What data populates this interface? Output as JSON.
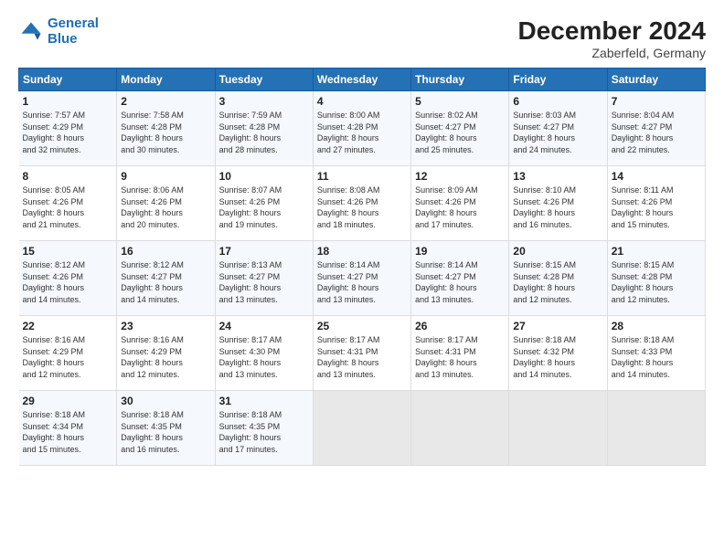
{
  "header": {
    "logo_line1": "General",
    "logo_line2": "Blue",
    "month_year": "December 2024",
    "location": "Zaberfeld, Germany"
  },
  "weekdays": [
    "Sunday",
    "Monday",
    "Tuesday",
    "Wednesday",
    "Thursday",
    "Friday",
    "Saturday"
  ],
  "weeks": [
    [
      {
        "day": "1",
        "text": "Sunrise: 7:57 AM\nSunset: 4:29 PM\nDaylight: 8 hours\nand 32 minutes."
      },
      {
        "day": "2",
        "text": "Sunrise: 7:58 AM\nSunset: 4:28 PM\nDaylight: 8 hours\nand 30 minutes."
      },
      {
        "day": "3",
        "text": "Sunrise: 7:59 AM\nSunset: 4:28 PM\nDaylight: 8 hours\nand 28 minutes."
      },
      {
        "day": "4",
        "text": "Sunrise: 8:00 AM\nSunset: 4:28 PM\nDaylight: 8 hours\nand 27 minutes."
      },
      {
        "day": "5",
        "text": "Sunrise: 8:02 AM\nSunset: 4:27 PM\nDaylight: 8 hours\nand 25 minutes."
      },
      {
        "day": "6",
        "text": "Sunrise: 8:03 AM\nSunset: 4:27 PM\nDaylight: 8 hours\nand 24 minutes."
      },
      {
        "day": "7",
        "text": "Sunrise: 8:04 AM\nSunset: 4:27 PM\nDaylight: 8 hours\nand 22 minutes."
      }
    ],
    [
      {
        "day": "8",
        "text": "Sunrise: 8:05 AM\nSunset: 4:26 PM\nDaylight: 8 hours\nand 21 minutes."
      },
      {
        "day": "9",
        "text": "Sunrise: 8:06 AM\nSunset: 4:26 PM\nDaylight: 8 hours\nand 20 minutes."
      },
      {
        "day": "10",
        "text": "Sunrise: 8:07 AM\nSunset: 4:26 PM\nDaylight: 8 hours\nand 19 minutes."
      },
      {
        "day": "11",
        "text": "Sunrise: 8:08 AM\nSunset: 4:26 PM\nDaylight: 8 hours\nand 18 minutes."
      },
      {
        "day": "12",
        "text": "Sunrise: 8:09 AM\nSunset: 4:26 PM\nDaylight: 8 hours\nand 17 minutes."
      },
      {
        "day": "13",
        "text": "Sunrise: 8:10 AM\nSunset: 4:26 PM\nDaylight: 8 hours\nand 16 minutes."
      },
      {
        "day": "14",
        "text": "Sunrise: 8:11 AM\nSunset: 4:26 PM\nDaylight: 8 hours\nand 15 minutes."
      }
    ],
    [
      {
        "day": "15",
        "text": "Sunrise: 8:12 AM\nSunset: 4:26 PM\nDaylight: 8 hours\nand 14 minutes."
      },
      {
        "day": "16",
        "text": "Sunrise: 8:12 AM\nSunset: 4:27 PM\nDaylight: 8 hours\nand 14 minutes."
      },
      {
        "day": "17",
        "text": "Sunrise: 8:13 AM\nSunset: 4:27 PM\nDaylight: 8 hours\nand 13 minutes."
      },
      {
        "day": "18",
        "text": "Sunrise: 8:14 AM\nSunset: 4:27 PM\nDaylight: 8 hours\nand 13 minutes."
      },
      {
        "day": "19",
        "text": "Sunrise: 8:14 AM\nSunset: 4:27 PM\nDaylight: 8 hours\nand 13 minutes."
      },
      {
        "day": "20",
        "text": "Sunrise: 8:15 AM\nSunset: 4:28 PM\nDaylight: 8 hours\nand 12 minutes."
      },
      {
        "day": "21",
        "text": "Sunrise: 8:15 AM\nSunset: 4:28 PM\nDaylight: 8 hours\nand 12 minutes."
      }
    ],
    [
      {
        "day": "22",
        "text": "Sunrise: 8:16 AM\nSunset: 4:29 PM\nDaylight: 8 hours\nand 12 minutes."
      },
      {
        "day": "23",
        "text": "Sunrise: 8:16 AM\nSunset: 4:29 PM\nDaylight: 8 hours\nand 12 minutes."
      },
      {
        "day": "24",
        "text": "Sunrise: 8:17 AM\nSunset: 4:30 PM\nDaylight: 8 hours\nand 13 minutes."
      },
      {
        "day": "25",
        "text": "Sunrise: 8:17 AM\nSunset: 4:31 PM\nDaylight: 8 hours\nand 13 minutes."
      },
      {
        "day": "26",
        "text": "Sunrise: 8:17 AM\nSunset: 4:31 PM\nDaylight: 8 hours\nand 13 minutes."
      },
      {
        "day": "27",
        "text": "Sunrise: 8:18 AM\nSunset: 4:32 PM\nDaylight: 8 hours\nand 14 minutes."
      },
      {
        "day": "28",
        "text": "Sunrise: 8:18 AM\nSunset: 4:33 PM\nDaylight: 8 hours\nand 14 minutes."
      }
    ],
    [
      {
        "day": "29",
        "text": "Sunrise: 8:18 AM\nSunset: 4:34 PM\nDaylight: 8 hours\nand 15 minutes."
      },
      {
        "day": "30",
        "text": "Sunrise: 8:18 AM\nSunset: 4:35 PM\nDaylight: 8 hours\nand 16 minutes."
      },
      {
        "day": "31",
        "text": "Sunrise: 8:18 AM\nSunset: 4:35 PM\nDaylight: 8 hours\nand 17 minutes."
      },
      {
        "day": "",
        "text": ""
      },
      {
        "day": "",
        "text": ""
      },
      {
        "day": "",
        "text": ""
      },
      {
        "day": "",
        "text": ""
      }
    ]
  ]
}
